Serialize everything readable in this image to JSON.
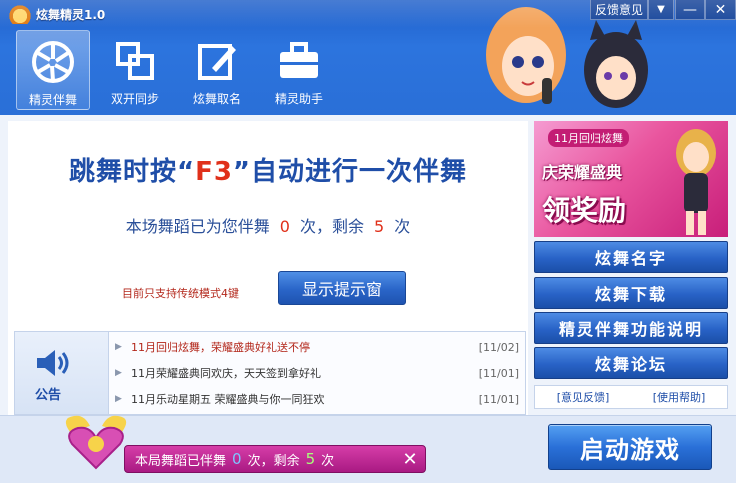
{
  "app": {
    "title": "炫舞精灵1.0"
  },
  "window_controls": {
    "feedback": "反馈意见",
    "menu_icon": "chevron-down-icon",
    "minimize_icon": "minimize-icon",
    "close_icon": "close-icon"
  },
  "nav": [
    {
      "label": "精灵伴舞",
      "icon": "aperture-icon",
      "active": true
    },
    {
      "label": "双开同步",
      "icon": "dual-window-icon",
      "active": false
    },
    {
      "label": "炫舞取名",
      "icon": "edit-icon",
      "active": false
    },
    {
      "label": "精灵助手",
      "icon": "briefcase-icon",
      "active": false
    }
  ],
  "main": {
    "headline_pre": "跳舞时按“",
    "headline_key": "F3",
    "headline_post": "”自动进行一次伴舞",
    "counter_pre": "本场舞蹈已为您伴舞",
    "counter_done": "0",
    "counter_mid": "次，剩余",
    "counter_left": "5",
    "counter_post": "次",
    "support_note": "目前只支持传统模式4键",
    "show_button": "显示提示窗"
  },
  "notice": {
    "label": "公告",
    "items": [
      {
        "title": "11月回归炫舞，荣耀盛典好礼送不停",
        "date": "[11/02]",
        "hot": true
      },
      {
        "title": "11月荣耀盛典同欢庆，天天签到拿好礼",
        "date": "[11/01]",
        "hot": false
      },
      {
        "title": "11月乐动星期五 荣耀盛典与你一同狂欢",
        "date": "[11/01]",
        "hot": false
      }
    ]
  },
  "banner": {
    "top": "11月回归炫舞",
    "line1": "庆荣耀盛典",
    "line2": "领奖励"
  },
  "sidebar": {
    "buttons": [
      "炫舞名字",
      "炫舞下载",
      "精灵伴舞功能说明",
      "炫舞论坛"
    ],
    "link_feedback": "[意见反馈]",
    "link_help": "[使用帮助]"
  },
  "footer": {
    "pill_pre": "本局舞蹈已伴舞",
    "pill_done": "0",
    "pill_mid": "次，剩余",
    "pill_left": "5",
    "pill_post": "次",
    "close_icon": "close-icon",
    "start_button": "启动游戏"
  },
  "colors": {
    "accent": "#2a6fd7",
    "highlight": "#e0301a",
    "pink": "#c81e7a"
  }
}
